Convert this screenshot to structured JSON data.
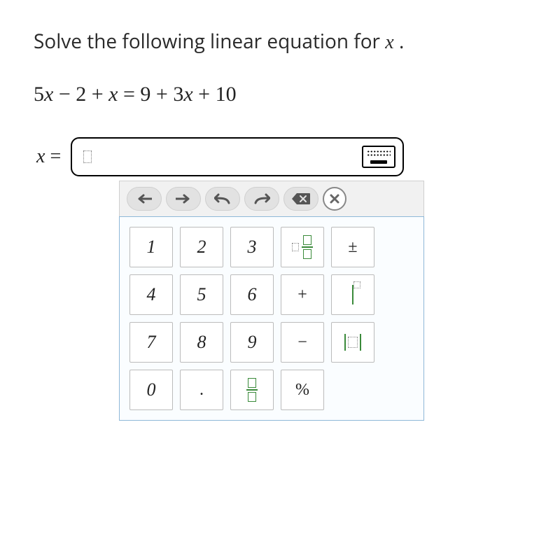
{
  "prompt": {
    "before_var": "Solve the following linear equation for ",
    "var": "x",
    "after_var": " ."
  },
  "equation": "5x − 2 + x = 9 + 3x + 10",
  "answer": {
    "label_var": "x",
    "label_eq": " = ",
    "value": ""
  },
  "toolbar": {
    "buttons": [
      "left",
      "right",
      "undo",
      "redo",
      "backspace",
      "clear"
    ]
  },
  "keypad": {
    "rows": [
      [
        "1",
        "2",
        "3",
        "mixed-fraction",
        "±"
      ],
      [
        "4",
        "5",
        "6",
        "+",
        "exponent"
      ],
      [
        "7",
        "8",
        "9",
        "−",
        "absolute-value"
      ],
      [
        "0",
        ".",
        "fraction",
        "%",
        ""
      ]
    ]
  }
}
